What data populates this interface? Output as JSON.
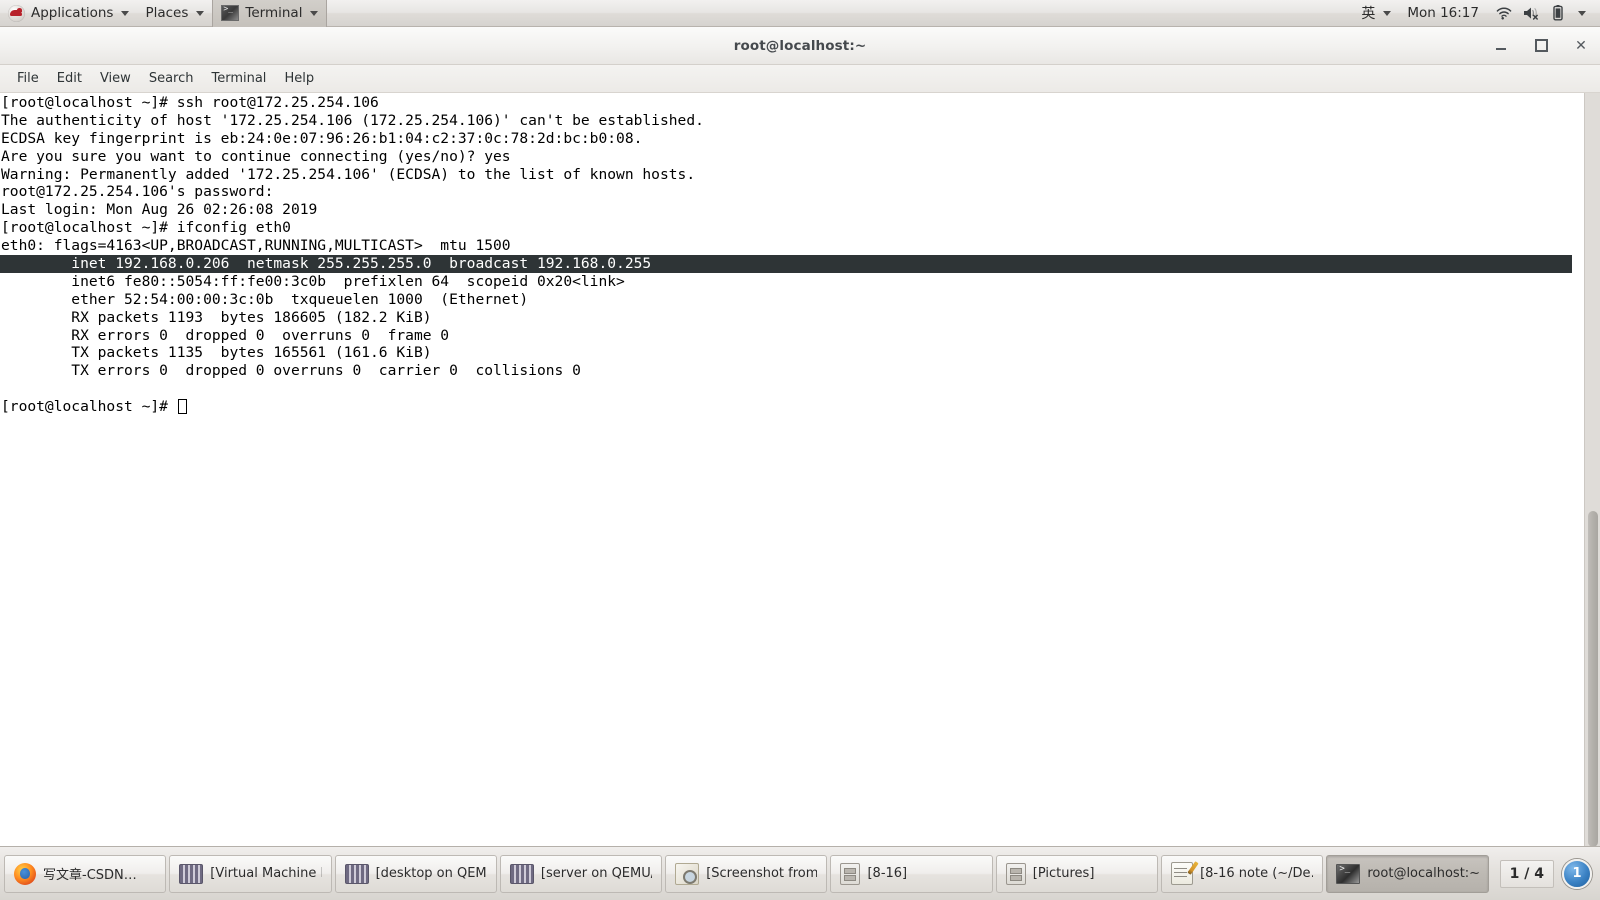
{
  "top_panel": {
    "applications_label": "Applications",
    "places_label": "Places",
    "active_window_label": "Terminal",
    "input_method": "英",
    "clock": "Mon 16:17",
    "icons": [
      "redhat-logo-icon",
      "wifi-icon",
      "volume-muted-icon",
      "battery-icon",
      "system-menu-caret-icon"
    ]
  },
  "window": {
    "title": "root@localhost:~",
    "controls": {
      "minimize": "minimize-button",
      "maximize": "maximize-button",
      "close": "close-button"
    }
  },
  "menu_bar": {
    "items": [
      {
        "label": "File"
      },
      {
        "label": "Edit"
      },
      {
        "label": "View"
      },
      {
        "label": "Search"
      },
      {
        "label": "Terminal"
      },
      {
        "label": "Help"
      }
    ]
  },
  "terminal": {
    "lines": [
      {
        "text": "[root@localhost ~]# ssh root@172.25.254.106",
        "selected": false
      },
      {
        "text": "The authenticity of host '172.25.254.106 (172.25.254.106)' can't be established.",
        "selected": false
      },
      {
        "text": "ECDSA key fingerprint is eb:24:0e:07:96:26:b1:04:c2:37:0c:78:2d:bc:b0:08.",
        "selected": false
      },
      {
        "text": "Are you sure you want to continue connecting (yes/no)? yes",
        "selected": false
      },
      {
        "text": "Warning: Permanently added '172.25.254.106' (ECDSA) to the list of known hosts.",
        "selected": false
      },
      {
        "text": "root@172.25.254.106's password:",
        "selected": false
      },
      {
        "text": "Last login: Mon Aug 26 02:26:08 2019",
        "selected": false
      },
      {
        "text": "[root@localhost ~]# ifconfig eth0",
        "selected": false
      },
      {
        "text": "eth0: flags=4163<UP,BROADCAST,RUNNING,MULTICAST>  mtu 1500",
        "selected": false
      },
      {
        "text": "        inet 192.168.0.206  netmask 255.255.255.0  broadcast 192.168.0.255",
        "selected": true
      },
      {
        "text": "        inet6 fe80::5054:ff:fe00:3c0b  prefixlen 64  scopeid 0x20<link>",
        "selected": false
      },
      {
        "text": "        ether 52:54:00:00:3c:0b  txqueuelen 1000  (Ethernet)",
        "selected": false
      },
      {
        "text": "        RX packets 1193  bytes 186605 (182.2 KiB)",
        "selected": false
      },
      {
        "text": "        RX errors 0  dropped 0  overruns 0  frame 0",
        "selected": false
      },
      {
        "text": "        TX packets 1135  bytes 165561 (161.6 KiB)",
        "selected": false
      },
      {
        "text": "        TX errors 0  dropped 0 overruns 0  carrier 0  collisions 0",
        "selected": false
      },
      {
        "text": "",
        "selected": false
      }
    ],
    "prompt": "[root@localhost ~]# ",
    "colors": {
      "background": "#ffffff",
      "foreground": "#000000",
      "selection_background": "#2e3436",
      "selection_foreground": "#ffffff"
    }
  },
  "taskbar": {
    "buttons": [
      {
        "label": "写文章-CSDN…",
        "icon": "firefox-icon",
        "active": false
      },
      {
        "label": "[Virtual Machine M…",
        "icon": "virt-manager-icon",
        "active": false
      },
      {
        "label": "[desktop on QEM…",
        "icon": "virt-manager-icon",
        "active": false
      },
      {
        "label": "[server on QEMU/…",
        "icon": "virt-manager-icon",
        "active": false
      },
      {
        "label": "[Screenshot from …",
        "icon": "screenshot-icon",
        "active": false
      },
      {
        "label": "[8-16]",
        "icon": "files-icon",
        "active": false
      },
      {
        "label": "[Pictures]",
        "icon": "files-icon",
        "active": false
      },
      {
        "label": "[8-16 note (~/De…",
        "icon": "notes-icon",
        "active": false
      },
      {
        "label": "root@localhost:~",
        "icon": "terminal-icon",
        "active": true
      }
    ],
    "pager": {
      "page_count_label": "1 / 4",
      "current_workspace": "1"
    }
  }
}
